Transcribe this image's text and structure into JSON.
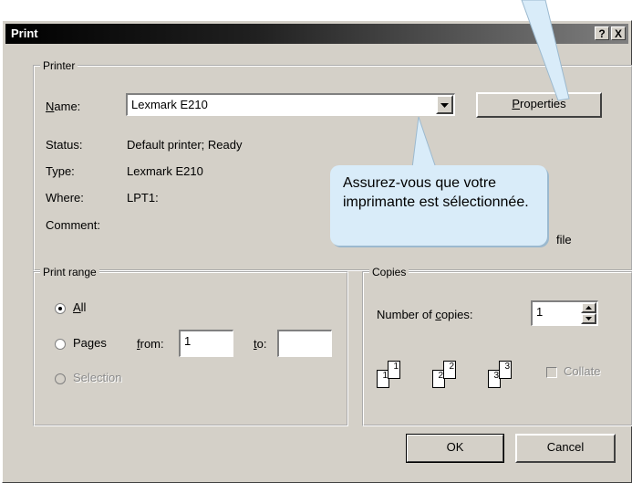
{
  "window": {
    "title": "Print",
    "help_btn": "?",
    "close_btn": "X"
  },
  "printer": {
    "legend": "Printer",
    "name_label_u": "N",
    "name_label_rest": "ame:",
    "name_value": "Lexmark E210",
    "properties_u": "P",
    "properties_rest": "roperties",
    "status_label": "Status:",
    "status_value": "Default printer; Ready",
    "type_label": "Type:",
    "type_value": "Lexmark E210",
    "where_label": "Where:",
    "where_value": "LPT1:",
    "comment_label": "Comment:",
    "print_to_file_tail": "file"
  },
  "print_range": {
    "legend": "Print range",
    "all_u": "A",
    "all_rest": "ll",
    "pages_label": "Pages",
    "from_u": "f",
    "from_rest": "rom:",
    "from_value": "1",
    "to_u": "t",
    "to_rest": "o:",
    "to_value": "",
    "selection_label": "Selection"
  },
  "copies": {
    "legend": "Copies",
    "number_label_pre": "Number of ",
    "number_label_u": "c",
    "number_label_rest": "opies:",
    "number_value": "1",
    "collate_label": "Collate",
    "pages": [
      "1",
      "1",
      "2",
      "2",
      "3",
      "3"
    ]
  },
  "buttons": {
    "ok": "OK",
    "cancel": "Cancel"
  },
  "callout": {
    "text": "Assurez-vous que votre imprimante est sélectionnée."
  },
  "colors": {
    "dialog_bg": "#d4d0c8",
    "callout_bg": "#d9ecf9"
  }
}
